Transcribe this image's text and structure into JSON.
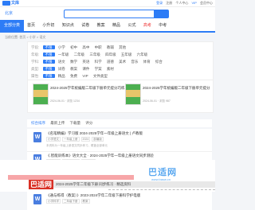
{
  "topbar": {
    "logo": "文库",
    "links": [
      "登录",
      "注册",
      "个人中心",
      "VIP",
      "会员中心"
    ]
  },
  "search": {
    "location": "北京",
    "placeholder": ""
  },
  "nav": {
    "all": "全部分类",
    "items": [
      "首页",
      "小升初",
      "知识点",
      "试卷",
      "教案",
      "精品",
      "公式",
      "高考",
      "中考"
    ],
    "hot_index": 7
  },
  "breadcrumb": "当前位置: 首页 > 小学 > 语文",
  "filters": {
    "rows": [
      {
        "label": "学段:",
        "selected": "不限",
        "options": [
          "小学",
          "初中",
          "高中",
          "中职",
          "教辅",
          "其他"
        ]
      },
      {
        "label": "年级:",
        "selected": "不限",
        "options": [
          "一年级",
          "二年级",
          "三年级",
          "四年级",
          "五年级",
          "六年级"
        ]
      },
      {
        "label": "学科:",
        "selected": "不限",
        "options": [
          "语文",
          "数学",
          "英语",
          "科学",
          "道德",
          "美术",
          "音乐",
          "体育",
          "综合"
        ]
      },
      {
        "label": "类型:",
        "selected": "不限",
        "options": [
          "试卷",
          "教案",
          "课件",
          "学案",
          "素材"
        ]
      },
      {
        "label": "属性:",
        "selected": "不限",
        "options": [
          "精品",
          "免费",
          "VIP",
          "文件类型"
        ]
      }
    ]
  },
  "featured": [
    {
      "title": "2024-2025学年统编版二年级下册单元提分巧练",
      "meta": "2024-06-01 · 浏览 1234"
    },
    {
      "title": "2024-2025学年统编版二年级下册单元提分",
      "meta": "2024-06-01 · 浏览 987"
    }
  ],
  "sort": {
    "options": [
      "综合排序",
      "最新上传",
      "下载量",
      "评分"
    ],
    "active": 0
  },
  "list": [
    {
      "title": "《名笔精编》学习版 2024-2025学年一年级上册语文 | 卢教版",
      "tags": [
        "小学语文",
        "一年级上册",
        "2024",
        "部编版"
      ],
      "desc": "本资料为一年级上册语文同步练习，覆盖全部单元"
    },
    {
      "title": "《.智能训练本》语文大全 · 2024-2025学年一年级上册语文同步测验",
      "tags": [
        "小学语文",
        "一年级上册",
        "同步练习"
      ],
      "desc": ""
    }
  ],
  "ad": {
    "watermark": "巴适网",
    "watermark_sub": "www.basw.cn",
    "promo": "巴适网",
    "ribbon": "2024-2025学年二年级下册 同步练习 · 精选资料"
  },
  "last": {
    "title": "《通与练得（教案）》2023-2024学年二年级下册科学护电版",
    "tags": [
      "小学科学",
      "二年级下册",
      "教案"
    ]
  },
  "colors": {
    "accent": "#2d7cf6",
    "hot": "#e33333",
    "promo": "#d93025"
  }
}
